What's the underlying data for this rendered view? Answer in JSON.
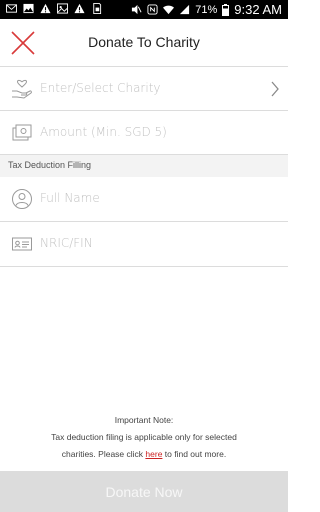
{
  "status_bar": {
    "battery": "71%",
    "time": "9:32 AM"
  },
  "header": {
    "title": "Donate To Charity"
  },
  "form": {
    "charity_placeholder": "Enter/Select Charity",
    "amount_placeholder": "Amount (Min. SGD 5)",
    "section_title": "Tax Deduction Filling",
    "fullname_placeholder": "Full Name",
    "nric_placeholder": "NRIC/FIN"
  },
  "note": {
    "heading": "Important Note:",
    "line1": "Tax deduction filing is applicable only for selected",
    "line2_before": "charities. Please click ",
    "link": "here",
    "line2_after": " to find out more."
  },
  "footer": {
    "donate_label": "Donate Now"
  },
  "colors": {
    "accent": "#cc2222",
    "divider": "#dcdcdc",
    "section_bg": "#f3f3f3",
    "button_bg": "#dcdcdc"
  }
}
